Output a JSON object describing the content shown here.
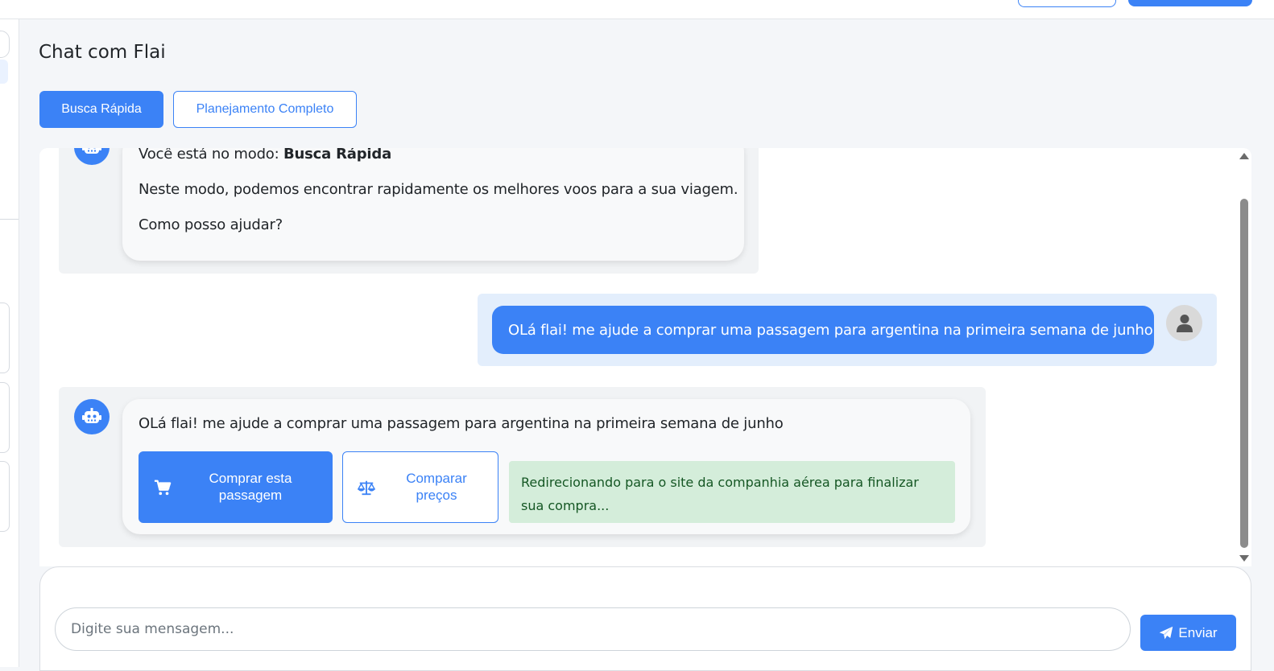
{
  "colors": {
    "primary": "#3b82f6",
    "success_bg": "#d4edda",
    "success_text": "#155724",
    "bot_bubble_bg": "#f8f9fa",
    "user_row_bg": "#e3eefc"
  },
  "page": {
    "title": "Chat com Flai"
  },
  "modes": {
    "quick_label": "Busca Rápida",
    "full_label": "Planejamento Completo",
    "active": "Busca Rápida"
  },
  "messages": {
    "bot_intro": {
      "prefix": "Você está no modo: ",
      "mode": "Busca Rápida",
      "line2": "Neste modo, podemos encontrar rapidamente os melhores voos para a sua viagem.",
      "line3": "Como posso ajudar?",
      "avatar_icon": "robot-icon"
    },
    "user_message": {
      "text": "OLá flai! me ajude a comprar uma passagem para argentina na primeira semana de junho",
      "avatar_icon": "user-icon"
    },
    "bot_reply": {
      "text": "OLá flai! me ajude a comprar uma passagem para argentina na primeira semana de junho",
      "avatar_icon": "robot-icon",
      "buy_label": "Comprar esta passagem",
      "buy_icon": "cart-icon",
      "compare_label": "Comparar preços",
      "compare_icon": "scale-icon",
      "redirect_note": "Redirecionando para o site da companhia aérea para finalizar sua compra..."
    }
  },
  "composer": {
    "placeholder": "Digite sua mensagem...",
    "value": "",
    "send_label": "Enviar",
    "send_icon": "paper-plane-icon"
  }
}
